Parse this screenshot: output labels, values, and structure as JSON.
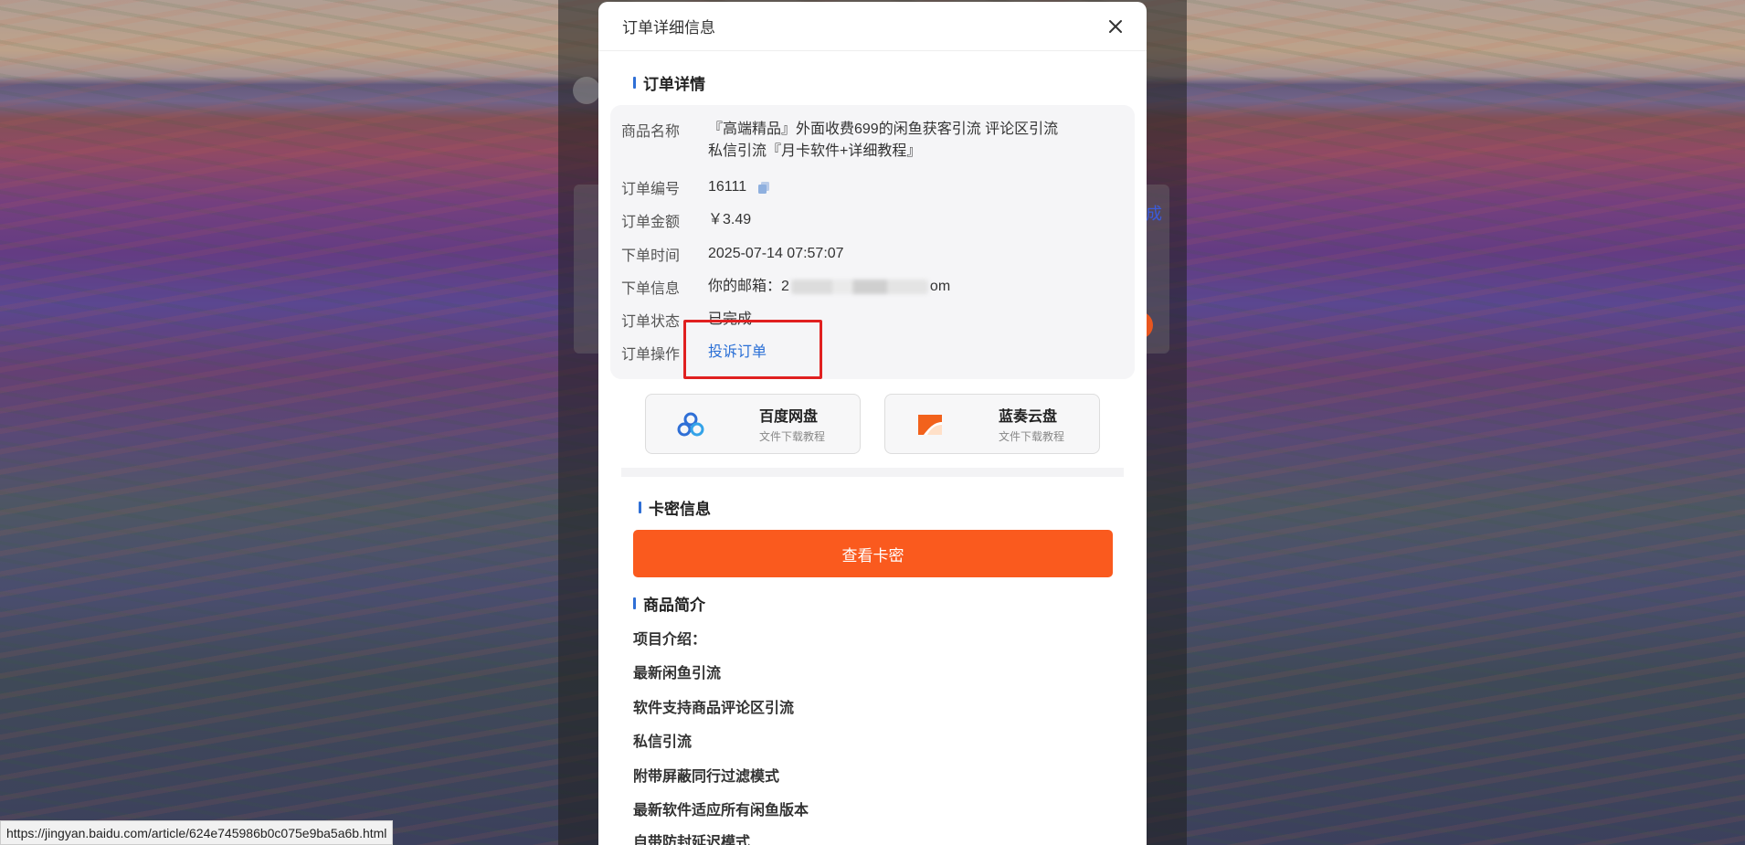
{
  "background_page": {
    "status_text_fragment": "成"
  },
  "modal": {
    "title": "订单详细信息",
    "order_section_title": "订单详情",
    "rows": {
      "product": {
        "label": "商品名称",
        "value_line1": "『高端精品』外面收费699的闲鱼获客引流 评论区引流",
        "value_line2": "私信引流『月卡软件+详细教程』"
      },
      "order_no": {
        "label": "订单编号",
        "value": "16111"
      },
      "amount": {
        "label": "订单金额",
        "value": "￥3.49"
      },
      "time": {
        "label": "下单时间",
        "value": "2025-07-14 07:57:07"
      },
      "info": {
        "label": "下单信息",
        "prefix": "你的邮箱：",
        "visible_start": "2",
        "visible_end": "om"
      },
      "status": {
        "label": "订单状态",
        "value": "已完成"
      },
      "action": {
        "label": "订单操作",
        "value": "投诉订单"
      }
    },
    "disks": [
      {
        "name": "百度网盘",
        "sub": "文件下载教程",
        "icon": "baidu-netdisk-icon"
      },
      {
        "name": "蓝奏云盘",
        "sub": "文件下载教程",
        "icon": "lanzou-cloud-icon"
      }
    ],
    "card_section_title": "卡密信息",
    "view_card_button": "查看卡密",
    "intro_section_title": "商品简介",
    "intro_lines": [
      "项目介绍：",
      "最新闲鱼引流",
      "软件支持商品评论区引流",
      "私信引流",
      "附带屏蔽同行过滤模式",
      "最新软件适应所有闲鱼版本",
      "自带防封延迟模式"
    ]
  },
  "status_bar": {
    "url": "https://jingyan.baidu.com/article/624e745986b0c075e9ba5a6b.html"
  },
  "colors": {
    "accent_blue": "#2f6fd6",
    "link_blue": "#2a6fd6",
    "button_orange": "#fa5a1e",
    "highlight_red": "#e02020"
  }
}
